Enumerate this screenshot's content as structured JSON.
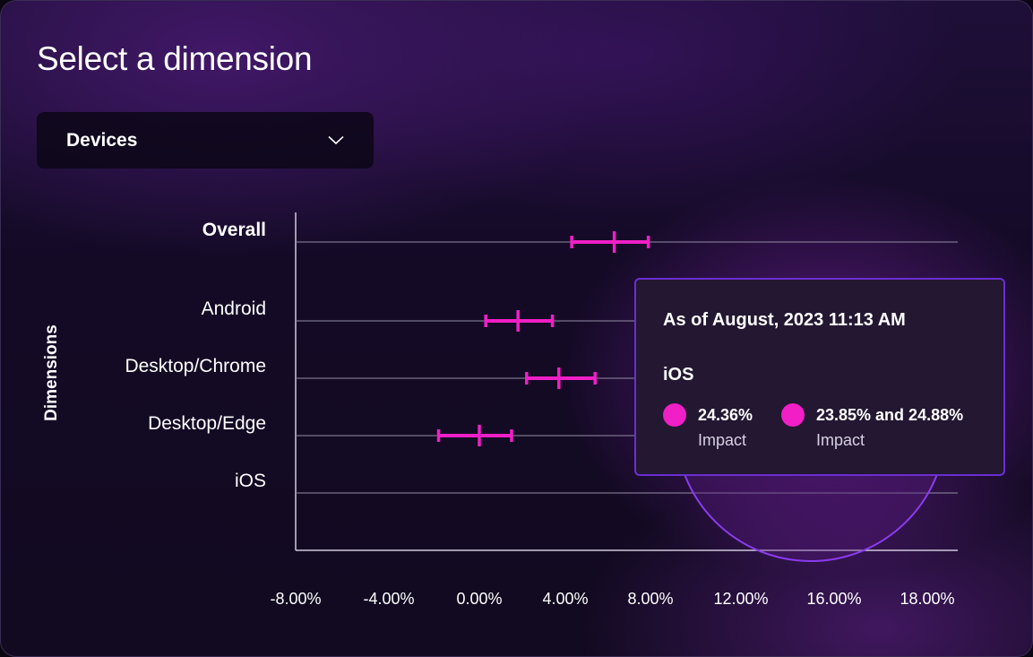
{
  "header": {
    "title": "Select a dimension"
  },
  "dropdown": {
    "selected": "Devices",
    "icon": "chevron-down-icon"
  },
  "colors": {
    "accent": "#f01fc6",
    "tooltip_border": "#6a2fd0",
    "grid": "#8e86a0"
  },
  "chart_data": {
    "type": "errorbar",
    "ylabel": "Dimensions",
    "xlabel": "",
    "categories": [
      "Overall",
      "Android",
      "Desktop/Chrome",
      "Desktop/Edge",
      "iOS"
    ],
    "bold_categories": [
      "Overall"
    ],
    "x_ticks": [
      "-8.00%",
      "-4.00%",
      "0.00%",
      "4.00%",
      "8.00%",
      "12.00%",
      "16.00%",
      "18.00%"
    ],
    "x_tick_values": [
      -8,
      -4,
      0,
      4,
      8,
      12,
      16,
      18
    ],
    "points": [
      {
        "category": "Overall",
        "value": 6.3,
        "low": 4.3,
        "high": 7.9
      },
      {
        "category": "Android",
        "value": 1.8,
        "low": 0.3,
        "high": 3.4
      },
      {
        "category": "Desktop/Chrome",
        "value": 3.7,
        "low": 2.2,
        "high": 5.4
      },
      {
        "category": "Desktop/Edge",
        "value": 0.0,
        "low": -1.8,
        "high": 1.5
      }
    ],
    "grid": true
  },
  "tooltip": {
    "date": "As of August, 2023 11:13 AM",
    "series": "iOS",
    "items": [
      {
        "value": "24.36%",
        "label": "Impact"
      },
      {
        "value": "23.85% and 24.88%",
        "label": "Impact"
      }
    ]
  }
}
